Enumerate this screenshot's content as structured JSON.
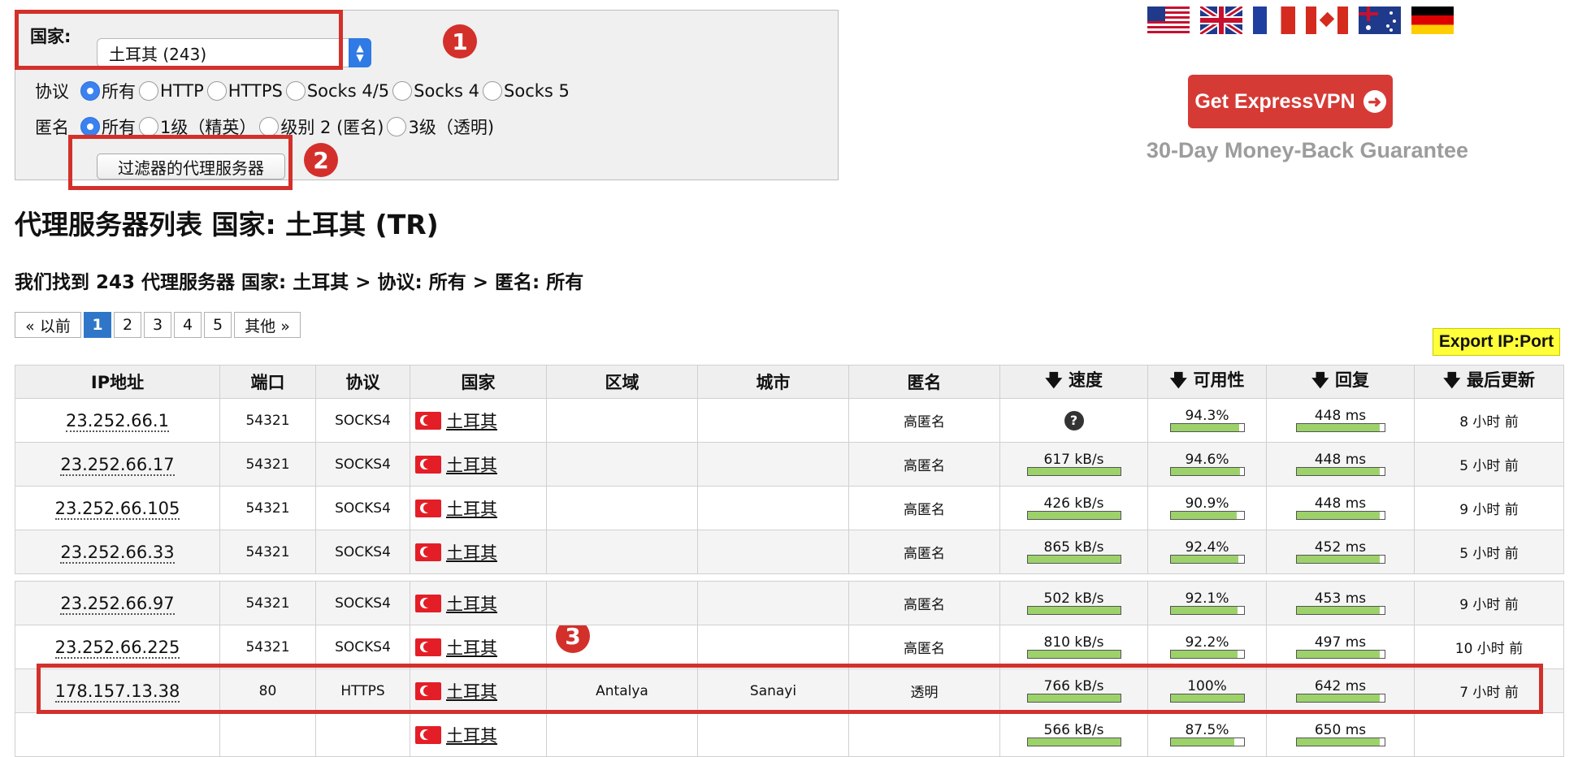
{
  "filter": {
    "country_label": "国家:",
    "country_value": "土耳其 (243)",
    "protocol_label": "协议",
    "protocol_options": [
      "所有",
      "HTTP",
      "HTTPS",
      "Socks 4/5",
      "Socks 4",
      "Socks 5"
    ],
    "protocol_selected": 0,
    "anonymity_label": "匿名",
    "anonymity_options": [
      "所有",
      "1级（精英）",
      "级别 2 (匿名)",
      "3级（透明)"
    ],
    "anonymity_selected": 0,
    "submit_label": "过滤器的代理服务器"
  },
  "annotations": [
    "1",
    "2",
    "3"
  ],
  "ad": {
    "vpn_button": "Get ExpressVPN",
    "guarantee": "30-Day Money-Back Guarantee",
    "flags": [
      "us-flag-icon",
      "uk-flag-icon",
      "fr-flag-icon",
      "ca-flag-icon",
      "au-flag-icon",
      "de-flag-icon"
    ]
  },
  "heading": "代理服务器列表 国家: 土耳其 (TR)",
  "summary": "我们找到 243 代理服务器 国家: 土耳其 > 协议: 所有 > 匿名: 所有",
  "pagination": {
    "prev": "« 以前",
    "pages": [
      "1",
      "2",
      "3",
      "4",
      "5"
    ],
    "active": "1",
    "more": "其他 »"
  },
  "export_label": "Export IP:Port",
  "table": {
    "columns": [
      "IP地址",
      "端口",
      "协议",
      "国家",
      "区域",
      "城市",
      "匿名",
      "速度",
      "可用性",
      "回复",
      "最后更新"
    ],
    "rows": [
      {
        "ip": "23.252.66.1",
        "port": "54321",
        "protocol": "SOCKS4",
        "country": "土耳其",
        "region": "",
        "city": "",
        "anonymity": "高匿名",
        "speed": "",
        "speed_pct": null,
        "uptime": "94.3%",
        "uptime_pct": 94.3,
        "response": "448 ms",
        "response_pct": 95,
        "updated": "8 小时 前"
      },
      {
        "ip": "23.252.66.17",
        "port": "54321",
        "protocol": "SOCKS4",
        "country": "土耳其",
        "region": "",
        "city": "",
        "anonymity": "高匿名",
        "speed": "617 kB/s",
        "speed_pct": 100,
        "uptime": "94.6%",
        "uptime_pct": 94.6,
        "response": "448 ms",
        "response_pct": 95,
        "updated": "5 小时 前"
      },
      {
        "ip": "23.252.66.105",
        "port": "54321",
        "protocol": "SOCKS4",
        "country": "土耳其",
        "region": "",
        "city": "",
        "anonymity": "高匿名",
        "speed": "426 kB/s",
        "speed_pct": 100,
        "uptime": "90.9%",
        "uptime_pct": 90.9,
        "response": "448 ms",
        "response_pct": 95,
        "updated": "9 小时 前"
      },
      {
        "ip": "23.252.66.33",
        "port": "54321",
        "protocol": "SOCKS4",
        "country": "土耳其",
        "region": "",
        "city": "",
        "anonymity": "高匿名",
        "speed": "865 kB/s",
        "speed_pct": 100,
        "uptime": "92.4%",
        "uptime_pct": 92.4,
        "response": "452 ms",
        "response_pct": 95,
        "updated": "5 小时 前"
      },
      {
        "ip": "23.252.66.97",
        "port": "54321",
        "protocol": "SOCKS4",
        "country": "土耳其",
        "region": "",
        "city": "",
        "anonymity": "高匿名",
        "speed": "502 kB/s",
        "speed_pct": 100,
        "uptime": "92.1%",
        "uptime_pct": 92.1,
        "response": "453 ms",
        "response_pct": 95,
        "updated": "9 小时 前"
      },
      {
        "ip": "23.252.66.225",
        "port": "54321",
        "protocol": "SOCKS4",
        "country": "土耳其",
        "region": "",
        "city": "",
        "anonymity": "高匿名",
        "speed": "810 kB/s",
        "speed_pct": 100,
        "uptime": "92.2%",
        "uptime_pct": 92.2,
        "response": "497 ms",
        "response_pct": 95,
        "updated": "10 小时 前"
      },
      {
        "ip": "178.157.13.38",
        "port": "80",
        "protocol": "HTTPS",
        "country": "土耳其",
        "region": "Antalya",
        "city": "Sanayi",
        "anonymity": "透明",
        "speed": "766 kB/s",
        "speed_pct": 100,
        "uptime": "100%",
        "uptime_pct": 100,
        "response": "642 ms",
        "response_pct": 95,
        "updated": "7 小时 前"
      },
      {
        "ip": "",
        "port": "",
        "protocol": "",
        "country": "土耳其",
        "region": "",
        "city": "",
        "anonymity": "",
        "speed": "566 kB/s",
        "speed_pct": 100,
        "uptime": "87.5%",
        "uptime_pct": 87.5,
        "response": "650 ms",
        "response_pct": 95,
        "updated": ""
      }
    ]
  }
}
